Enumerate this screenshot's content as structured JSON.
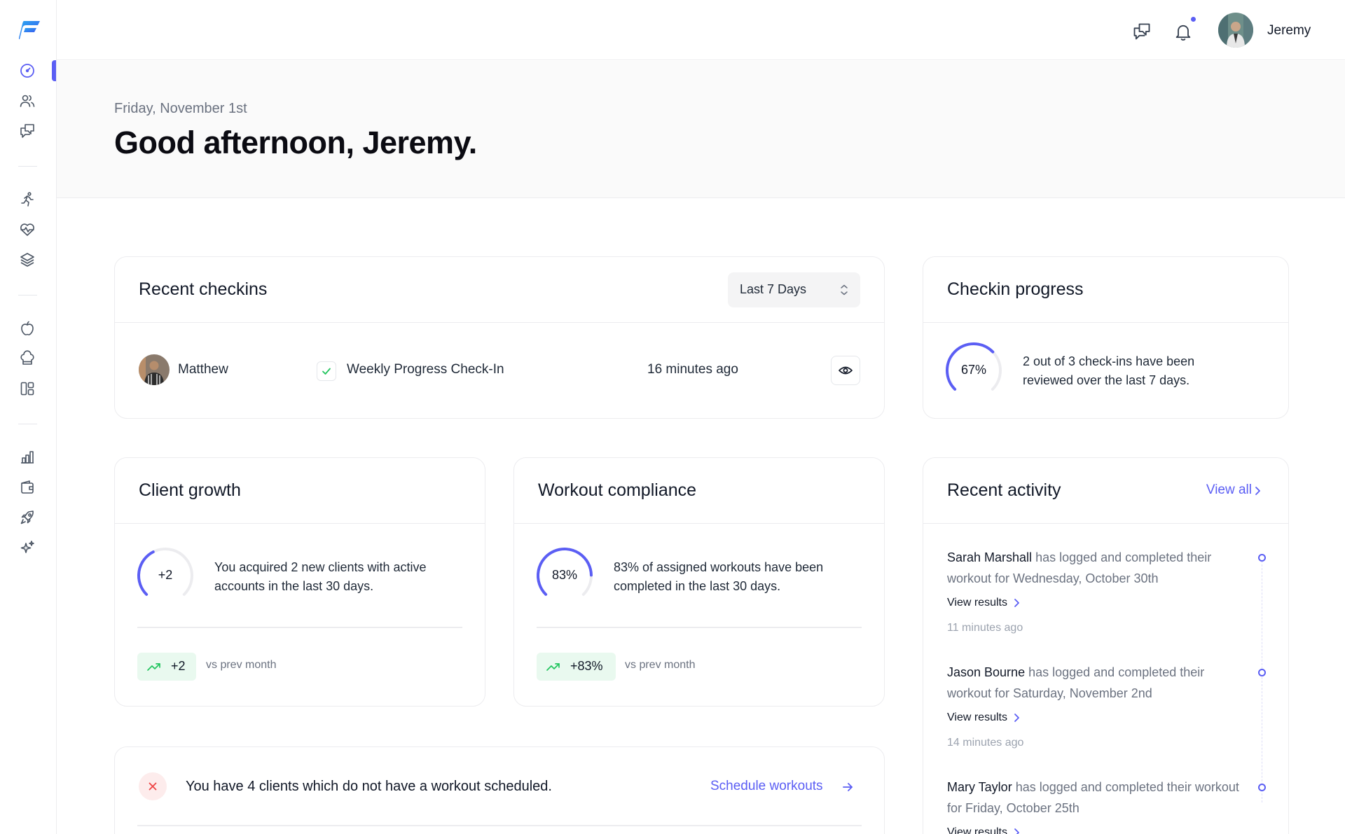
{
  "app": {
    "brand_color": "#5b5ef4"
  },
  "sidebar": {
    "items": [
      {
        "icon": "dashboard-icon",
        "active": true
      },
      {
        "icon": "users-icon"
      },
      {
        "icon": "messages-icon"
      },
      {
        "icon": "running-icon"
      },
      {
        "icon": "heart-pulse-icon"
      },
      {
        "icon": "layers-icon"
      },
      {
        "icon": "apple-icon"
      },
      {
        "icon": "chef-hat-icon"
      },
      {
        "icon": "layout-icon"
      },
      {
        "icon": "chart-icon"
      },
      {
        "icon": "wallet-icon"
      },
      {
        "icon": "rocket-icon"
      },
      {
        "icon": "sparkles-icon"
      }
    ]
  },
  "header": {
    "user_name": "Jeremy",
    "has_notification": true
  },
  "hero": {
    "date": "Friday, November 1st",
    "greeting": "Good afternoon, Jeremy."
  },
  "recent_checkins": {
    "title": "Recent checkins",
    "range_select": {
      "value": "Last 7 Days"
    },
    "rows": [
      {
        "client": "Matthew",
        "checkin": "Weekly Progress Check-In",
        "time": "16 minutes ago"
      }
    ]
  },
  "checkin_progress": {
    "title": "Checkin progress",
    "percent": 67,
    "percent_label": "67%",
    "description": "2 out of 3 check-ins have been reviewed over the last 7 days."
  },
  "client_growth": {
    "title": "Client growth",
    "ring_label": "+2",
    "ring_fraction": 0.4,
    "description": "You acquired 2 new clients with active accounts in the last 30 days.",
    "delta": "+2",
    "compare_text": "vs prev month"
  },
  "workout_compliance": {
    "title": "Workout compliance",
    "ring_label": "83%",
    "ring_fraction": 0.83,
    "description": "83% of assigned workouts have been completed in the last 30 days.",
    "delta": "+83%",
    "compare_text": "vs prev month"
  },
  "recent_activity": {
    "title": "Recent activity",
    "view_all": "View all",
    "items": [
      {
        "name": "Sarah Marshall",
        "text": " has logged and completed their workout for Wednesday, October 30th",
        "link": "View results",
        "time": "11 minutes ago"
      },
      {
        "name": "Jason Bourne",
        "text": " has logged and completed their workout for Saturday, November 2nd",
        "link": "View results",
        "time": "14 minutes ago"
      },
      {
        "name": "Mary Taylor",
        "text": " has logged and completed their workout for Friday, October 25th",
        "link": "View results",
        "time": ""
      }
    ]
  },
  "alert": {
    "text": "You have 4 clients which do not have a workout scheduled.",
    "action": "Schedule workouts"
  }
}
